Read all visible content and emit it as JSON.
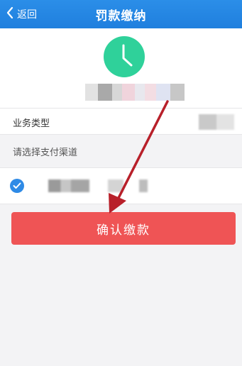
{
  "header": {
    "back_label": "返回",
    "title": "罚款缴纳"
  },
  "top_card": {
    "icon": "clock-icon",
    "amount_obscured": true
  },
  "fields": {
    "business_type_label": "业务类型"
  },
  "payment": {
    "section_label": "请选择支付渠道",
    "selected": true
  },
  "actions": {
    "confirm_label": "确认缴款"
  },
  "colors": {
    "header_blue": "#1f7fde",
    "clock_green": "#2fd19a",
    "confirm_red": "#ef5455",
    "check_blue": "#2e8ae6",
    "arrow_red": "#b8202a"
  }
}
